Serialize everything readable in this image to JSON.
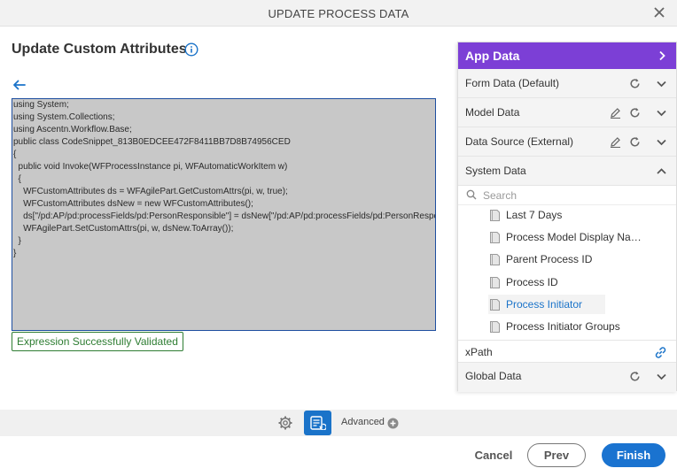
{
  "dialog": {
    "title": "UPDATE PROCESS DATA"
  },
  "main": {
    "title": "Update Custom Attributes",
    "code_lines": [
      "using System;",
      "using System.Collections;",
      "using Ascentn.Workflow.Base;",
      "public class CodeSnippet_813B0EDCEE472F8411BB7D8B74956CED",
      "{",
      "  public void Invoke(WFProcessInstance pi, WFAutomaticWorkItem w)",
      "  {",
      "    WFCustomAttributes ds = WFAgilePart.GetCustomAttrs(pi, w, true);",
      "    WFCustomAttributes dsNew = new WFCustomAttributes();",
      "    ds[\"/pd:AP/pd:processFields/pd:PersonResponsible\"] = dsNew[\"/pd:AP/pd:processFields/pd:PersonResponsible\"];",
      "",
      "    WFAgilePart.SetCustomAttrs(pi, w, dsNew.ToArray());",
      "  }",
      "}"
    ],
    "validation_message": "Expression Successfully Validated"
  },
  "app_data": {
    "header": "App Data",
    "sections": {
      "form_data": "Form Data (Default)",
      "model_data": "Model Data",
      "data_source": "Data Source (External)",
      "system_data": "System Data",
      "global_data": "Global Data"
    },
    "search_placeholder": "Search",
    "system_items": [
      "Last 7 Days",
      "Process Model Display Na…",
      "Parent Process ID",
      "Process ID",
      "Process Initiator",
      "Process Initiator Groups"
    ],
    "selected_item": "Process Initiator",
    "xpath_label": "xPath"
  },
  "toolbar": {
    "advanced_label": "Advanced"
  },
  "footer": {
    "cancel": "Cancel",
    "prev": "Prev",
    "finish": "Finish"
  },
  "colors": {
    "accent_purple": "#7c3fd6",
    "primary_blue": "#1a73d0",
    "success_green": "#2e7d32",
    "code_bg": "#c8c8c8"
  }
}
